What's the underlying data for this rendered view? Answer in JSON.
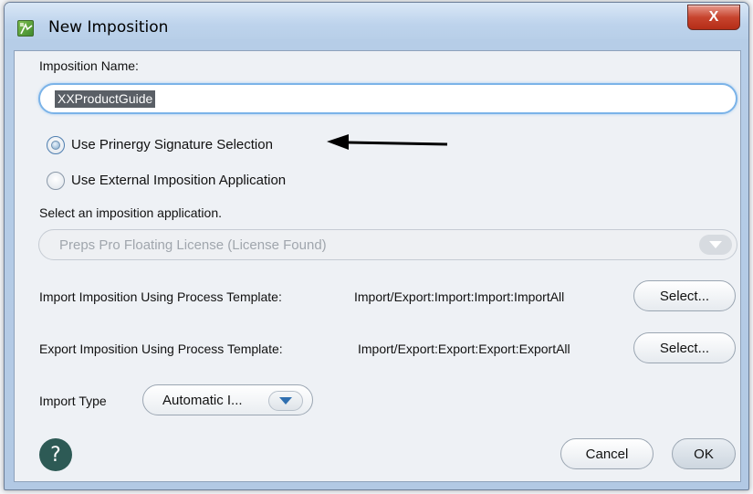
{
  "window": {
    "title": "New Imposition",
    "close_label": "X"
  },
  "form": {
    "imposition_name_label": "Imposition Name:",
    "imposition_name_value": "XXProductGuide",
    "radio_prinergy": "Use Prinergy Signature Selection",
    "radio_external": "Use External Imposition Application",
    "selected_radio": "Use Prinergy Signature Selection",
    "select_app_label": "Select an imposition application.",
    "app_select_value": "Preps Pro Floating License (License Found)",
    "import_label": "Import Imposition Using Process Template:",
    "import_value": "Import/Export:Import:Import:ImportAll",
    "import_button": "Select...",
    "export_label": "Export Imposition Using Process Template:",
    "export_value": "Import/Export:Export:Export:ExportAll",
    "export_button": "Select...",
    "import_type_label": "Import Type",
    "import_type_value": "Automatic I..."
  },
  "footer": {
    "help_label": "?",
    "cancel_label": "Cancel",
    "ok_label": "OK"
  },
  "icons": {
    "app": "imposition-app-icon",
    "dropdown": "chevron-down-icon",
    "annotation": "arrow-left-icon"
  },
  "colors": {
    "help_button": "#2d5a55",
    "close_button": "#c7442e",
    "focus_ring": "#7bb3e8",
    "dropdown_arrow": "#2f6fb0"
  }
}
